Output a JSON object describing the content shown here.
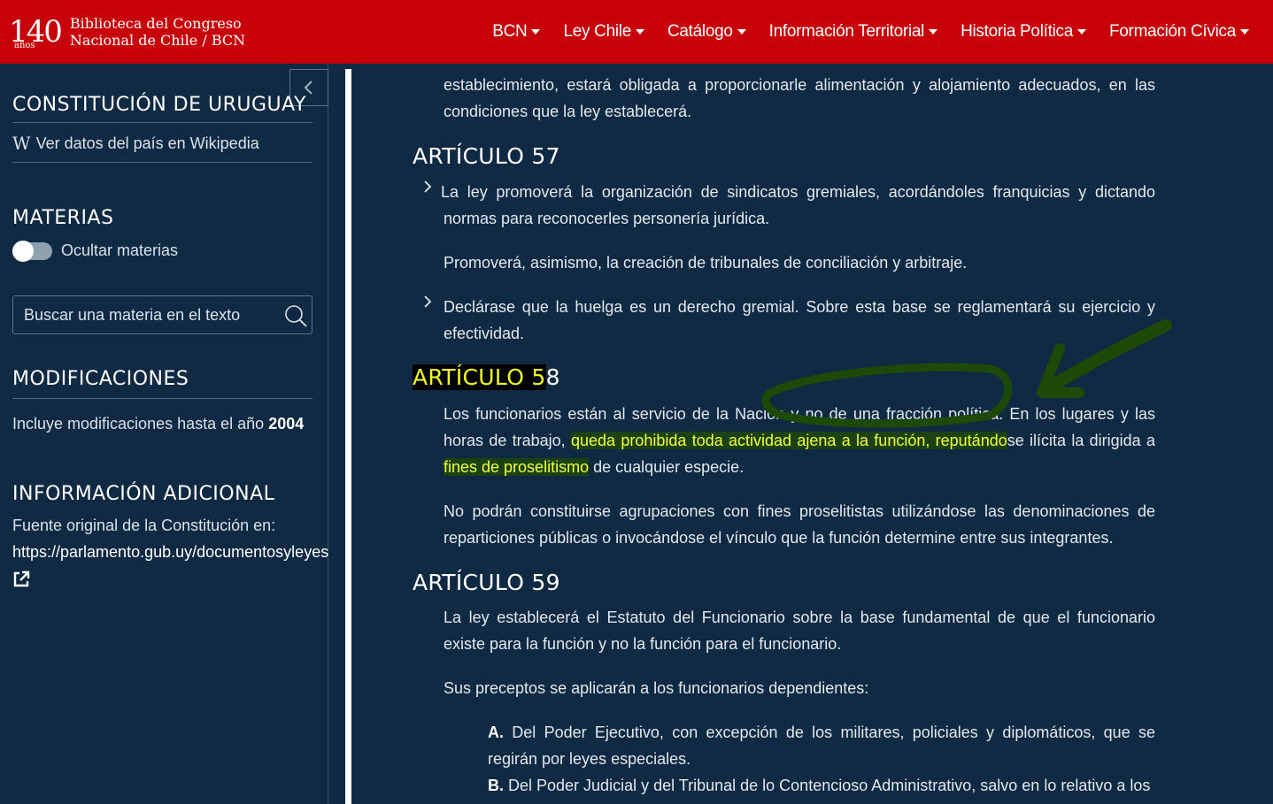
{
  "header": {
    "logo_number": "140",
    "logo_years": "años",
    "logo_line1": "Biblioteca del Congreso",
    "logo_line2": "Nacional de Chile / BCN",
    "nav": [
      "BCN",
      "Ley Chile",
      "Catálogo",
      "Información Territorial",
      "Historia Política",
      "Formación Cívica"
    ]
  },
  "sidebar": {
    "collapse_icon": "chevron-left-icon",
    "title": "CONSTITUCIÓN DE URUGUAY",
    "wiki_glyph": "W",
    "wiki_link": "Ver datos del país en Wikipedia",
    "materias_title": "MATERIAS",
    "toggle_label": "Ocultar materias",
    "search_placeholder": "Buscar una materia en el texto",
    "modificaciones_title": "MODIFICACIONES",
    "modificaciones_text": "Incluye modificaciones hasta el año",
    "modificaciones_year": "2004",
    "info_title": "INFORMACIÓN ADICIONAL",
    "info_text": "Fuente original de la Constitución en:",
    "info_url": "https://parlamento.gub.uy/documentosyleyes"
  },
  "content": {
    "p_top": "establecimiento, estará obligada a proporcionarle alimentación y alojamiento adecuados, en las condiciones que la ley establecerá.",
    "art57_title": "ARTÍCULO 57",
    "art57_p1": "La ley promoverá la organización de sindicatos gremiales, acordándoles franquicias y dictando normas para reconocerles personería jurídica.",
    "art57_p2": "Promoverá, asimismo, la creación de tribunales de conciliación y arbitraje.",
    "art57_p3": "Declárase que la huelga es un derecho gremial. Sobre esta base se reglamentará su ejercicio y efectividad.",
    "art58_title_a": "ARTÍCULO 5",
    "art58_title_b": "8",
    "art58_p1_a": "Los funcionarios están al servicio de la Nación y no de una fracción política. En los lugares y las horas de trabajo, ",
    "art58_p1_hl1": "queda prohibida toda actividad ajena a la función, reputándo",
    "art58_p1_b": "se ilícita la dirigida a ",
    "art58_p1_hl2": "fines de proselitismo",
    "art58_p1_c": " de cualquier especie.",
    "art58_p2": "No podrán constituirse agrupaciones con fines proselitistas utilizándose las denominaciones de reparticiones públicas o invocándose el vínculo que la función determine entre sus integrantes.",
    "art59_title": "ARTÍCULO 59",
    "art59_p1": "La ley establecerá el Estatuto del Funcionario sobre la base fundamental de que el funcionario existe para la función y no la función para el funcionario.",
    "art59_p2": "Sus preceptos se aplicarán a los funcionarios dependientes:",
    "art59_a_letter": "A.",
    "art59_a": " Del Poder Ejecutivo, con excepción de los militares, policiales y diplomáticos, que se regirán por leyes especiales.",
    "art59_b_letter": "B.",
    "art59_b": " Del Poder Judicial y del Tribunal de lo Contencioso Administrativo, salvo en lo relativo a los"
  },
  "colors": {
    "topbar": "#c8000a",
    "background": "#0f2a42",
    "highlight_text": "#f0ff40",
    "annotation": "#1d4a08"
  }
}
